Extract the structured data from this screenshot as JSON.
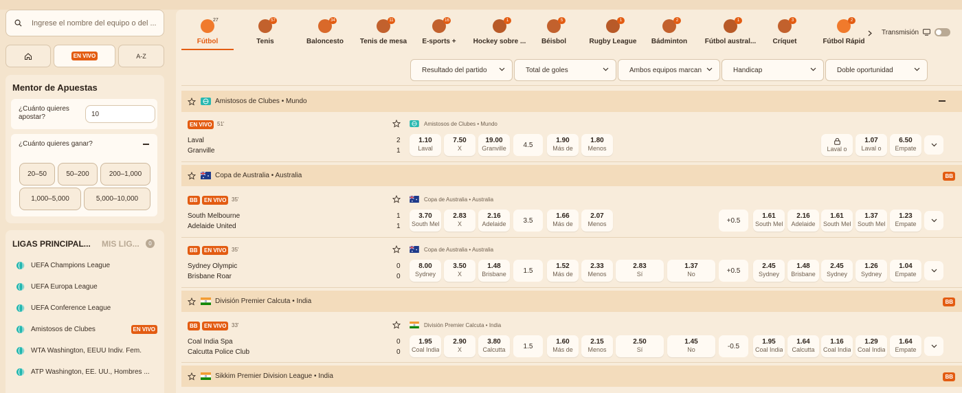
{
  "search": {
    "placeholder": "Ingrese el nombre del equipo o del ..."
  },
  "nav": {
    "home_icon": "home-icon",
    "live_label": "EN VIVO",
    "az_label": "A-Z"
  },
  "mentor": {
    "title": "Mentor de Apuestas",
    "stake_question": "¿Cuánto quieres apostar?",
    "stake_value": "10",
    "win_question": "¿Cuánto quieres ganar?",
    "ranges": [
      "20–50",
      "50–200",
      "200–1,000",
      "1,000–5,000",
      "5,000–10,000"
    ]
  },
  "leagues_panel": {
    "tab_main": "LIGAS PRINCIPAL...",
    "tab_mine": "MIS LIG...",
    "mine_count": "0",
    "items": [
      {
        "label": "UEFA Champions League",
        "live": ""
      },
      {
        "label": "UEFA Europa League",
        "live": ""
      },
      {
        "label": "UEFA Conference League",
        "live": ""
      },
      {
        "label": "Amistosos de Clubes",
        "live": "EN VIVO"
      },
      {
        "label": "WTA Washington, EEUU Indiv. Fem.",
        "live": ""
      },
      {
        "label": "ATP Washington, EE. UU., Hombres ...",
        "live": ""
      }
    ]
  },
  "sports_tabs": [
    {
      "label": "Fútbol",
      "count": "27",
      "icon": "football-icon",
      "color": "#f07a2c"
    },
    {
      "label": "Tenis",
      "count": "57",
      "icon": "tennis-icon",
      "color": "#c2612d"
    },
    {
      "label": "Baloncesto",
      "count": "34",
      "icon": "basketball-icon",
      "color": "#d9692a"
    },
    {
      "label": "Tenis de mesa",
      "count": "11",
      "icon": "table-tennis-icon",
      "color": "#c2612d"
    },
    {
      "label": "E-sports +",
      "count": "16",
      "icon": "gamepad-icon",
      "color": "#c2612d"
    },
    {
      "label": "Hockey sobre ...",
      "count": "1",
      "icon": "hockey-icon",
      "color": "#b85a28"
    },
    {
      "label": "Béisbol",
      "count": "5",
      "icon": "baseball-icon",
      "color": "#c2612d"
    },
    {
      "label": "Rugby League",
      "count": "1",
      "icon": "rugby-icon",
      "color": "#b85a28"
    },
    {
      "label": "Bádminton",
      "count": "2",
      "icon": "shuttlecock-icon",
      "color": "#c2612d"
    },
    {
      "label": "Fútbol austral...",
      "count": "1",
      "icon": "aussie-football-icon",
      "color": "#b85a28"
    },
    {
      "label": "Críquet",
      "count": "3",
      "icon": "cricket-icon",
      "color": "#c2612d"
    },
    {
      "label": "Fútbol Rápid",
      "count": "2",
      "icon": "futsal-icon",
      "color": "#f07a2c"
    }
  ],
  "transmission": {
    "label": "Transmisión"
  },
  "filters": [
    "Resultado del partido",
    "Total de goles",
    "Ambos equipos marcan",
    "Handicap",
    "Doble oportunidad"
  ],
  "league_headers": [
    {
      "name": "Amistosos de Clubes • Mundo",
      "bb": ""
    },
    {
      "name": "Copa de Australia • Australia",
      "bb": "BB"
    },
    {
      "name": "División Premier Calcuta • India",
      "bb": "BB"
    },
    {
      "name": "Sikkim Premier Division League • India",
      "bb": "BB"
    }
  ],
  "matches": [
    {
      "bb": "",
      "live": "EN VIVO",
      "minute": "51'",
      "league": "Amistosos de Clubes • Mundo",
      "home": "Laval",
      "away": "Granville",
      "home_score": "2",
      "away_score": "1",
      "odds": [
        {
          "v": "1.10",
          "l": "Laval"
        },
        {
          "v": "7.50",
          "l": "X"
        },
        {
          "v": "19.00",
          "l": "Granville"
        }
      ],
      "total": "4.5",
      "ou": [
        {
          "v": "1.90",
          "l": "Más de"
        },
        {
          "v": "1.80",
          "l": "Menos"
        }
      ],
      "btts": [],
      "hcp": "",
      "hcp_odds": [],
      "dc": [
        {
          "v": "",
          "l": "Laval o"
        },
        {
          "v": "1.07",
          "l": "Laval o"
        },
        {
          "v": "6.50",
          "l": "Empate"
        }
      ]
    },
    {
      "bb": "BB",
      "live": "EN VIVO",
      "minute": "35'",
      "league": "Copa de Australia • Australia",
      "home": "South Melbourne",
      "away": "Adelaide United",
      "home_score": "1",
      "away_score": "1",
      "odds": [
        {
          "v": "3.70",
          "l": "South Melbourne"
        },
        {
          "v": "2.83",
          "l": "X"
        },
        {
          "v": "2.16",
          "l": "Adelaide"
        }
      ],
      "total": "3.5",
      "ou": [
        {
          "v": "1.66",
          "l": "Más de"
        },
        {
          "v": "2.07",
          "l": "Menos"
        }
      ],
      "btts": [],
      "hcp": "+0.5",
      "hcp_odds": [
        {
          "v": "1.61",
          "l": "South Melbourne"
        },
        {
          "v": "2.16",
          "l": "Adelaide"
        }
      ],
      "dc": [
        {
          "v": "1.61",
          "l": "South Melbourne"
        },
        {
          "v": "1.37",
          "l": "South Melbourne"
        },
        {
          "v": "1.23",
          "l": "Empate"
        }
      ]
    },
    {
      "bb": "BB",
      "live": "EN VIVO",
      "minute": "35'",
      "league": "Copa de Australia • Australia",
      "home": "Sydney Olympic",
      "away": "Brisbane Roar",
      "home_score": "0",
      "away_score": "0",
      "odds": [
        {
          "v": "8.00",
          "l": "Sydney"
        },
        {
          "v": "3.50",
          "l": "X"
        },
        {
          "v": "1.48",
          "l": "Brisbane"
        }
      ],
      "total": "1.5",
      "ou": [
        {
          "v": "1.52",
          "l": "Más de"
        },
        {
          "v": "2.33",
          "l": "Menos"
        }
      ],
      "btts": [
        {
          "v": "2.83",
          "l": "Sí"
        },
        {
          "v": "1.37",
          "l": "No"
        }
      ],
      "hcp": "+0.5",
      "hcp_odds": [
        {
          "v": "2.45",
          "l": "Sydney"
        },
        {
          "v": "1.48",
          "l": "Brisbane"
        }
      ],
      "dc": [
        {
          "v": "2.45",
          "l": "Sydney"
        },
        {
          "v": "1.26",
          "l": "Sydney"
        },
        {
          "v": "1.04",
          "l": "Empate"
        }
      ]
    },
    {
      "bb": "BB",
      "live": "EN VIVO",
      "minute": "33'",
      "league": "División Premier Calcuta • India",
      "home": "Coal India Spa",
      "away": "Calcutta Police Club",
      "home_score": "0",
      "away_score": "0",
      "odds": [
        {
          "v": "1.95",
          "l": "Coal India"
        },
        {
          "v": "2.90",
          "l": "X"
        },
        {
          "v": "3.80",
          "l": "Calcutta"
        }
      ],
      "total": "1.5",
      "ou": [
        {
          "v": "1.60",
          "l": "Más de"
        },
        {
          "v": "2.15",
          "l": "Menos"
        }
      ],
      "btts": [
        {
          "v": "2.50",
          "l": "Sí"
        },
        {
          "v": "1.45",
          "l": "No"
        }
      ],
      "hcp": "-0.5",
      "hcp_odds": [
        {
          "v": "1.95",
          "l": "Coal India"
        },
        {
          "v": "1.64",
          "l": "Calcutta"
        }
      ],
      "dc": [
        {
          "v": "1.16",
          "l": "Coal India"
        },
        {
          "v": "1.29",
          "l": "Coal India"
        },
        {
          "v": "1.64",
          "l": "Empate"
        }
      ]
    }
  ],
  "colors": {
    "accent": "#e35c12",
    "background": "#f4e4cd",
    "panel": "#f8ecdb",
    "card": "#fffaf3",
    "league_header": "#f3dcbc"
  }
}
